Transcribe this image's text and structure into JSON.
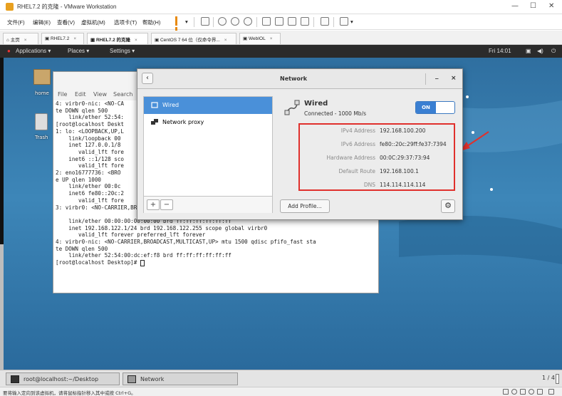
{
  "vm": {
    "title": "RHEL7.2 的克隆 - VMware Workstation",
    "menus": [
      "文件(F)",
      "编辑(E)",
      "查看(V)",
      "虚拟机(M)",
      "选项卡(T)",
      "帮助(H)"
    ],
    "tabs": [
      {
        "label": "主页"
      },
      {
        "label": "RHEL7.2"
      },
      {
        "label": "RHEL7.2 的克隆",
        "active": true
      },
      {
        "label": "CentOS 7 64 位（仅命令界..."
      },
      {
        "label": "WebIOL"
      }
    ],
    "status_message": "要将输入定向到该虚拟机，请将鼠标指针移入其中或按 Ctrl+G。"
  },
  "gnome": {
    "applications": "Applications ▾",
    "places": "Places ▾",
    "settings": "Settings ▾",
    "clock": "Fri 14:01"
  },
  "desktop": {
    "home_label": "home",
    "trash_label": "Trash"
  },
  "terminal": {
    "menus": [
      "File",
      "Edit",
      "View",
      "Search"
    ],
    "lines": [
      "4: virbr0-nic: <NO-CA",
      "te DOWN qlen 500",
      "    link/ether 52:54:",
      "[root@localhost Deskt",
      "1: lo: <LOOPBACK,UP,L",
      "    link/loopback 00",
      "    inet 127.0.0.1/8",
      "       valid_lft fore",
      "    inet6 ::1/128 sco",
      "       valid_lft fore",
      "2: eno16777736: <BRO",
      "e UP qlen 1000",
      "    link/ether 00:0c",
      "    inet6 fe80::20c:2",
      "       valid_lft fore",
      "3: virbr0: <NO-CARRIER,BROADCAST,MULTICAST,UP> mtu 1500 qdisc noqueue state DOWN",
      "",
      "    link/ether 00:00:00:00:00:00 brd ff:ff:ff:ff:ff:ff",
      "    inet 192.168.122.1/24 brd 192.168.122.255 scope global virbr0",
      "       valid_lft forever preferred_lft forever",
      "4: virbr0-nic: <NO-CARRIER,BROADCAST,MULTICAST,UP> mtu 1500 qdisc pfifo_fast sta",
      "te DOWN qlen 500",
      "    link/ether 52:54:00:dc:ef:f8 brd ff:ff:ff:ff:ff:ff",
      "[root@localhost Desktop]# "
    ]
  },
  "network": {
    "title": "Network",
    "minimize": "_",
    "close": "×",
    "sidebar": [
      {
        "label": "Wired",
        "icon": "wired-icon",
        "selected": true
      },
      {
        "label": "Network proxy",
        "icon": "proxy-icon",
        "selected": false
      }
    ],
    "add": "+",
    "remove": "−",
    "wired_name": "Wired",
    "wired_status": "Connected - 1000 Mb/s",
    "toggle_label": "ON",
    "details": [
      {
        "label": "IPv4 Address",
        "value": "192.168.100.200"
      },
      {
        "label": "IPv6 Address",
        "value": "fe80::20c:29ff:fe37:7394"
      },
      {
        "label": "Hardware Address",
        "value": "00:0C:29:37:73:94"
      },
      {
        "label": "Default Route",
        "value": "192.168.100.1"
      },
      {
        "label": "DNS",
        "value": "114.114.114.114"
      }
    ],
    "add_profile": "Add Profile..."
  },
  "taskbar": {
    "items": [
      {
        "label": "root@localhost:~/Desktop"
      },
      {
        "label": "Network"
      }
    ],
    "workspace": "1 / 4"
  },
  "colors": {
    "highlight": "#e0302c",
    "selection": "#4a90d9",
    "desktop": "#3d86b8"
  }
}
